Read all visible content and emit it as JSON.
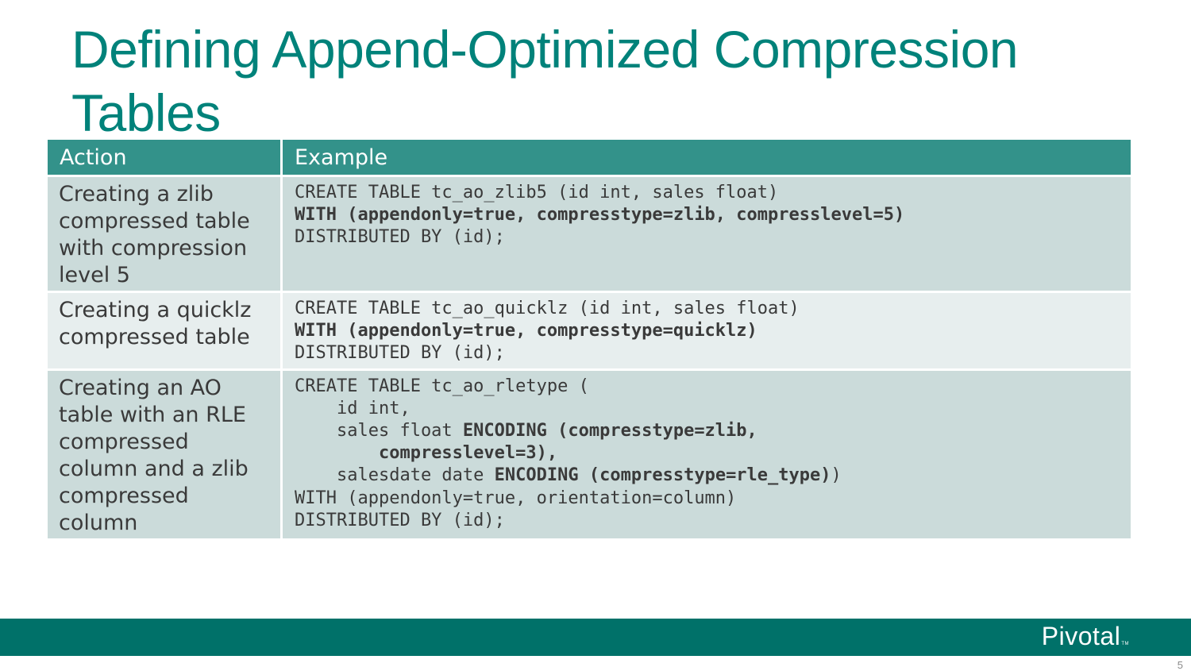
{
  "title": "Defining Append-Optimized Compression Tables",
  "table": {
    "headers": [
      "Action",
      "Example"
    ],
    "rows": [
      {
        "action": "Creating a zlib compressed table with compression level 5",
        "code_lines": [
          {
            "segments": [
              {
                "text": "CREATE TABLE tc_ao_zlib5 (id int, sales float)",
                "bold": false
              }
            ]
          },
          {
            "segments": [
              {
                "text": "WITH (appendonly=true, compresstype=zlib, compresslevel=5)",
                "bold": true
              }
            ]
          },
          {
            "segments": [
              {
                "text": "DISTRIBUTED BY (id);",
                "bold": false
              }
            ]
          }
        ]
      },
      {
        "action": "Creating a quicklz compressed table",
        "code_lines": [
          {
            "segments": [
              {
                "text": "CREATE TABLE tc_ao_quicklz (id int, sales float)",
                "bold": false
              }
            ]
          },
          {
            "segments": [
              {
                "text": "WITH (appendonly=true, compresstype=quicklz)",
                "bold": true
              }
            ]
          },
          {
            "segments": [
              {
                "text": "DISTRIBUTED BY (id);",
                "bold": false
              }
            ]
          }
        ]
      },
      {
        "action": "Creating an AO table with an RLE compressed column and a zlib compressed column",
        "code_lines": [
          {
            "segments": [
              {
                "text": "CREATE TABLE tc_ao_rletype (",
                "bold": false
              }
            ]
          },
          {
            "segments": [
              {
                "text": "    id int,",
                "bold": false
              }
            ]
          },
          {
            "segments": [
              {
                "text": "    sales float ",
                "bold": false
              },
              {
                "text": "ENCODING (compresstype=zlib,",
                "bold": true
              }
            ]
          },
          {
            "segments": [
              {
                "text": "        compresslevel=3),",
                "bold": true
              }
            ]
          },
          {
            "segments": [
              {
                "text": "    salesdate date ",
                "bold": false
              },
              {
                "text": "ENCODING (compresstype=rle_type)",
                "bold": true
              },
              {
                "text": ")",
                "bold": false
              }
            ]
          },
          {
            "segments": [
              {
                "text": "WITH (appendonly=true, orientation=column)",
                "bold": false
              }
            ]
          },
          {
            "segments": [
              {
                "text": "DISTRIBUTED BY (id);",
                "bold": false
              }
            ]
          }
        ]
      }
    ]
  },
  "footer": {
    "logo_text": "Pivotal",
    "logo_tm": "TM",
    "page_number": "5"
  },
  "colors": {
    "title": "#00827a",
    "header_bg": "#33928a",
    "row_dark": "#cbdbda",
    "row_light": "#e7eeee",
    "footer_bg": "#007169"
  }
}
